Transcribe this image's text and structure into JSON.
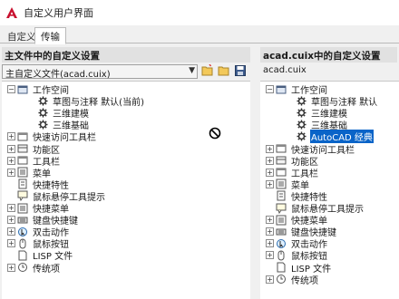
{
  "window": {
    "title": "自定义用户界面"
  },
  "tabs": [
    {
      "label": "自定义"
    },
    {
      "label": "传输"
    }
  ],
  "left_panel": {
    "header": "主文件中的自定义设置",
    "file_selector": "主自定义文件(acad.cuix)",
    "tree": [
      {
        "label": "工作空间",
        "icon": "workspace-icon",
        "expander": "-",
        "indent": 0
      },
      {
        "label": "草图与注释 默认(当前)",
        "icon": "gear-icon",
        "expander": "",
        "indent": 1
      },
      {
        "label": "三维建模",
        "icon": "gear-icon",
        "expander": "",
        "indent": 1
      },
      {
        "label": "三维基础",
        "icon": "gear-icon",
        "expander": "",
        "indent": 1
      },
      {
        "label": "快速访问工具栏",
        "icon": "toolbar-icon",
        "expander": "+",
        "indent": 0
      },
      {
        "label": "功能区",
        "icon": "ribbon-icon",
        "expander": "+",
        "indent": 0
      },
      {
        "label": "工具栏",
        "icon": "toolbar-icon",
        "expander": "+",
        "indent": 0
      },
      {
        "label": "菜单",
        "icon": "menu-icon",
        "expander": "+",
        "indent": 0
      },
      {
        "label": "快捷特性",
        "icon": "properties-icon",
        "expander": "",
        "indent": 0
      },
      {
        "label": "鼠标悬停工具提示",
        "icon": "tooltip-icon",
        "expander": "",
        "indent": 0
      },
      {
        "label": "快捷菜单",
        "icon": "menu-icon",
        "expander": "+",
        "indent": 0
      },
      {
        "label": "键盘快捷键",
        "icon": "keyboard-icon",
        "expander": "+",
        "indent": 0
      },
      {
        "label": "双击动作",
        "icon": "double-click-icon",
        "expander": "+",
        "indent": 0
      },
      {
        "label": "鼠标按钮",
        "icon": "mouse-icon",
        "expander": "+",
        "indent": 0
      },
      {
        "label": "LISP 文件",
        "icon": "lisp-file-icon",
        "expander": "",
        "indent": 0
      },
      {
        "label": "传统项",
        "icon": "legacy-icon",
        "expander": "+",
        "indent": 0
      }
    ]
  },
  "right_panel": {
    "header": "acad.cuix中的自定义设置",
    "file_label": "acad.cuix",
    "tree": [
      {
        "label": "工作空间",
        "icon": "workspace-icon",
        "expander": "-",
        "indent": 0
      },
      {
        "label": "草图与注释 默认",
        "icon": "gear-icon",
        "expander": "",
        "indent": 1
      },
      {
        "label": "三维建模",
        "icon": "gear-icon",
        "expander": "",
        "indent": 1
      },
      {
        "label": "三维基础",
        "icon": "gear-icon",
        "expander": "",
        "indent": 1
      },
      {
        "label": "AutoCAD 经典",
        "icon": "gear-icon",
        "expander": "",
        "indent": 1,
        "selected": true
      },
      {
        "label": "快速访问工具栏",
        "icon": "toolbar-icon",
        "expander": "+",
        "indent": 0
      },
      {
        "label": "功能区",
        "icon": "ribbon-icon",
        "expander": "+",
        "indent": 0
      },
      {
        "label": "工具栏",
        "icon": "toolbar-icon",
        "expander": "+",
        "indent": 0
      },
      {
        "label": "菜单",
        "icon": "menu-icon",
        "expander": "+",
        "indent": 0
      },
      {
        "label": "快捷特性",
        "icon": "properties-icon",
        "expander": "",
        "indent": 0
      },
      {
        "label": "鼠标悬停工具提示",
        "icon": "tooltip-icon",
        "expander": "",
        "indent": 0
      },
      {
        "label": "快捷菜单",
        "icon": "menu-icon",
        "expander": "+",
        "indent": 0
      },
      {
        "label": "键盘快捷键",
        "icon": "keyboard-icon",
        "expander": "+",
        "indent": 0
      },
      {
        "label": "双击动作",
        "icon": "double-click-icon",
        "expander": "+",
        "indent": 0
      },
      {
        "label": "鼠标按钮",
        "icon": "mouse-icon",
        "expander": "+",
        "indent": 0
      },
      {
        "label": "LISP 文件",
        "icon": "lisp-file-icon",
        "expander": "",
        "indent": 0
      },
      {
        "label": "传统项",
        "icon": "legacy-icon",
        "expander": "+",
        "indent": 0
      }
    ]
  },
  "colors": {
    "selection": "#0a64c8",
    "app_icon": "#c8102e"
  }
}
